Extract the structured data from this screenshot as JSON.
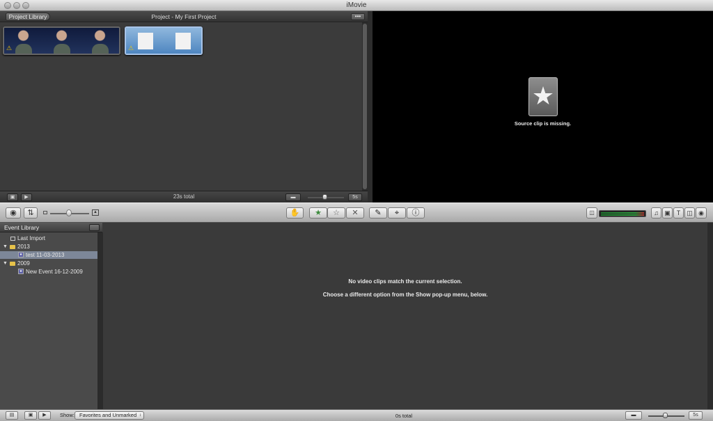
{
  "window": {
    "title": "iMovie"
  },
  "project": {
    "library_button": "Project Library",
    "title": "Project - My First Project",
    "total": "23s total",
    "zoom_value": "5s",
    "menu_glyph": "•••"
  },
  "viewer": {
    "missing_text": "Source clip is missing."
  },
  "event_library": {
    "header": "Event Library",
    "items": [
      {
        "label": "Last Import",
        "kind": "last-import"
      },
      {
        "label": "2013",
        "kind": "year-folder"
      },
      {
        "label": "test 11-03-2013",
        "kind": "event",
        "selected": true
      },
      {
        "label": "2009",
        "kind": "year-folder"
      },
      {
        "label": "New Event 16-12-2009",
        "kind": "event"
      }
    ]
  },
  "event_browser": {
    "empty_title": "No video clips match the current selection.",
    "empty_hint": "Choose a different option from the Show pop-up menu, below."
  },
  "bottom_bar": {
    "show_label": "Show:",
    "show_value": "Favorites and Unmarked",
    "total": "0s total",
    "zoom_value": "5s"
  },
  "colors": {
    "selection": "#7d8798",
    "star": "#4caf50",
    "reject": "#c0392b"
  },
  "icons": [
    "camera-icon",
    "swap-icon",
    "mark-favorite-icon",
    "unmark-icon",
    "reject-icon",
    "eyedropper-icon",
    "crop-icon",
    "info-icon",
    "music-icon",
    "photo-icon",
    "title-icon",
    "transition-icon",
    "map-icon"
  ]
}
